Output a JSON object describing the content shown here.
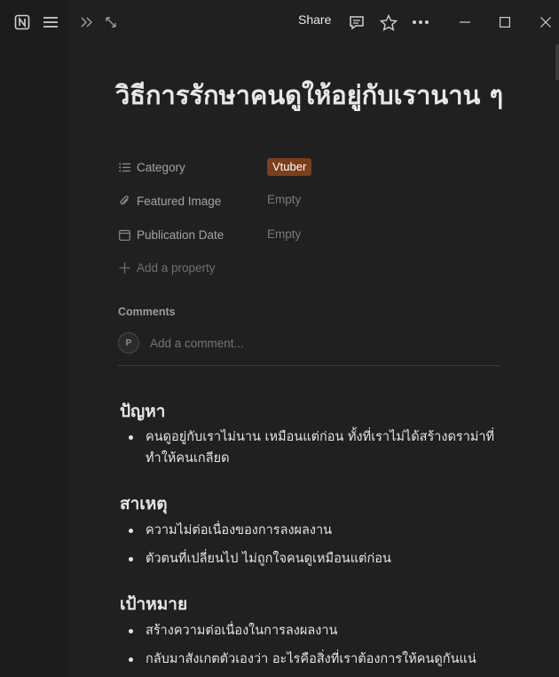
{
  "topbar": {
    "share_label": "Share"
  },
  "page": {
    "title": "วิธีการรักษาคนดูให้อยู่กับเรานาน ๆ"
  },
  "properties": [
    {
      "label": "Category",
      "value": "Vtuber",
      "icon": "list-icon"
    },
    {
      "label": "Featured Image",
      "value": "Empty",
      "icon": "paperclip-icon"
    },
    {
      "label": "Publication Date",
      "value": "Empty",
      "icon": "calendar-icon"
    }
  ],
  "add_property_label": "Add a property",
  "comments": {
    "title": "Comments",
    "avatar_initial": "P",
    "placeholder": "Add a comment..."
  },
  "sections": [
    {
      "heading": "ปัญหา",
      "items": [
        "คนดูอยู่กับเราไม่นาน เหมือนแต่ก่อน ทั้งที่เราไม่ได้สร้างดราม่าที่ทำให้คนเกลียด"
      ]
    },
    {
      "heading": "สาเหตุ",
      "items": [
        "ความไม่ต่อเนื่องของการลงผลงาน",
        "ตัวตนที่เปลี่ยนไป ไม่ถูกใจคนดูเหมือนแต่ก่อน"
      ]
    },
    {
      "heading": "เป้าหมาย",
      "items": [
        "สร้างความต่อเนื่องในการลงผลงาน",
        "กลับมาสังเกตตัวเองว่า อะไรคือสิ่งที่เราต้องการให้คนดูกันแน่"
      ]
    }
  ],
  "colors": {
    "tag_bg": "#7b3f1c",
    "background": "#202020"
  }
}
